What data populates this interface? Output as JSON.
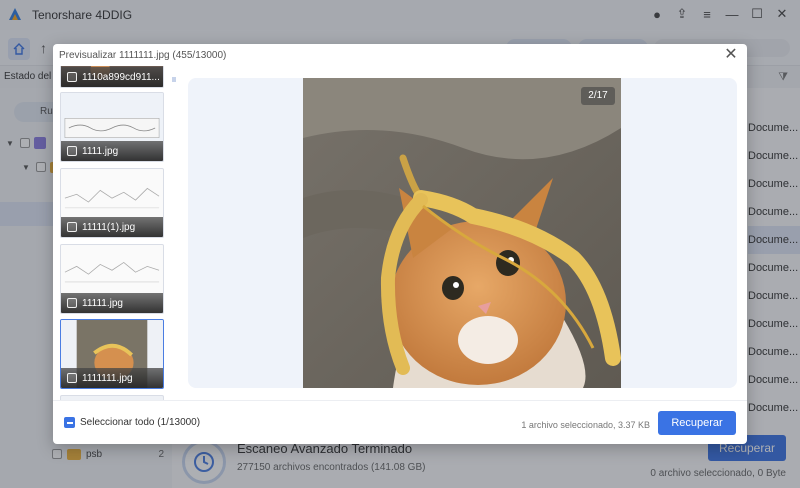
{
  "app": {
    "title": "Tenorshare 4DDIG"
  },
  "toolbar": {
    "status_label": "Estado del a"
  },
  "sidebar": {
    "tab_label": "Ru",
    "psb": {
      "name": "psb",
      "count": "2"
    }
  },
  "file_types": [
    "Docume...",
    "Docume...",
    "Docume...",
    "Docume...",
    "Docume...",
    "Docume...",
    "Docume...",
    "Docume...",
    "Docume...",
    "Docume...",
    "Docume..."
  ],
  "scan": {
    "title": "Escaneo Avanzado Terminado",
    "subtitle": "277150 archivos encontrados (141.08 GB)",
    "recover_label": "Recuperar",
    "selected_info": "0 archivo seleccionado, 0 Byte"
  },
  "modal": {
    "title": "Previsualizar 1111111.jpg (455/13000)",
    "page_indicator": "2/17",
    "thumbnails": [
      {
        "name": "1110a899cd911..."
      },
      {
        "name": "1111.jpg"
      },
      {
        "name": "11111(1).jpg"
      },
      {
        "name": "11111.jpg"
      },
      {
        "name": "1111111.jpg"
      }
    ],
    "select_all_label": "Seleccionar todo (1/13000)",
    "selected_info": "1 archivo seleccionado, 3.37 KB",
    "recover_label": "Recuperar"
  },
  "colors": {
    "accent": "#3a73e4",
    "folder": "#f1b33b"
  }
}
